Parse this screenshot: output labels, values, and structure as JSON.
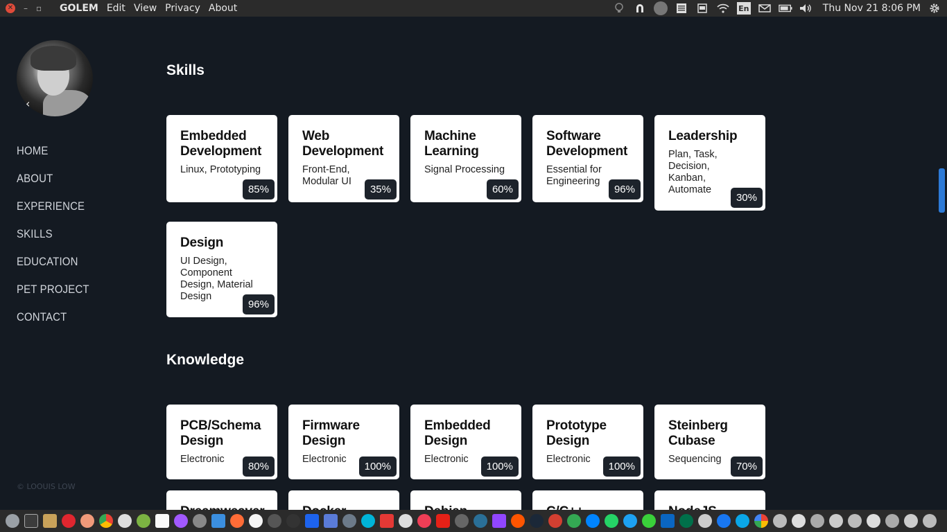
{
  "topbar": {
    "close_glyph": "✕",
    "min_glyph": "–",
    "max_glyph": "▫",
    "app_title": "GOLEM",
    "menu": [
      "Edit",
      "View",
      "Privacy",
      "About"
    ],
    "tray": {
      "lang": "En",
      "clock": "Thu Nov 21  8:06 PM"
    }
  },
  "sidebar": {
    "back_glyph": "‹",
    "nav": [
      "HOME",
      "ABOUT",
      "EXPERIENCE",
      "SKILLS",
      "EDUCATION",
      "PET PROJECT",
      "CONTACT"
    ],
    "copyright": "© LOOUIS LOW"
  },
  "skills": {
    "title": "Skills",
    "cards": [
      {
        "title": "Embedded Development",
        "desc": "Linux, Prototyping",
        "percent": "85%"
      },
      {
        "title": "Web Development",
        "desc": "Front-End, Modular UI",
        "percent": "35%"
      },
      {
        "title": "Machine Learning",
        "desc": "Signal Processing",
        "percent": "60%"
      },
      {
        "title": "Software Development",
        "desc": "Essential for Engineering",
        "percent": "96%"
      },
      {
        "title": "Leadership",
        "desc": "Plan, Task, Decision, Kanban, Automate",
        "percent": "30%"
      },
      {
        "title": "Design",
        "desc": "UI Design, Component Design, Material Design",
        "percent": "96%"
      }
    ]
  },
  "knowledge": {
    "title": "Knowledge",
    "cards": [
      {
        "title": "PCB/Schema Design",
        "desc": "Electronic",
        "percent": "80%"
      },
      {
        "title": "Firmware Design",
        "desc": "Electronic",
        "percent": "100%"
      },
      {
        "title": "Embedded Design",
        "desc": "Electronic",
        "percent": "100%"
      },
      {
        "title": "Prototype Design",
        "desc": "Electronic",
        "percent": "100%"
      },
      {
        "title": "Steinberg Cubase",
        "desc": "Sequencing",
        "percent": "70%"
      }
    ],
    "partial_cards": [
      "Dreamweaver",
      "Docker",
      "Debian",
      "C/C++",
      "NodeJS"
    ]
  },
  "colors": {
    "background": "#141a22",
    "card": "#ffffff",
    "badge": "#1d232b",
    "scroll_thumb": "#2d7ad6"
  }
}
